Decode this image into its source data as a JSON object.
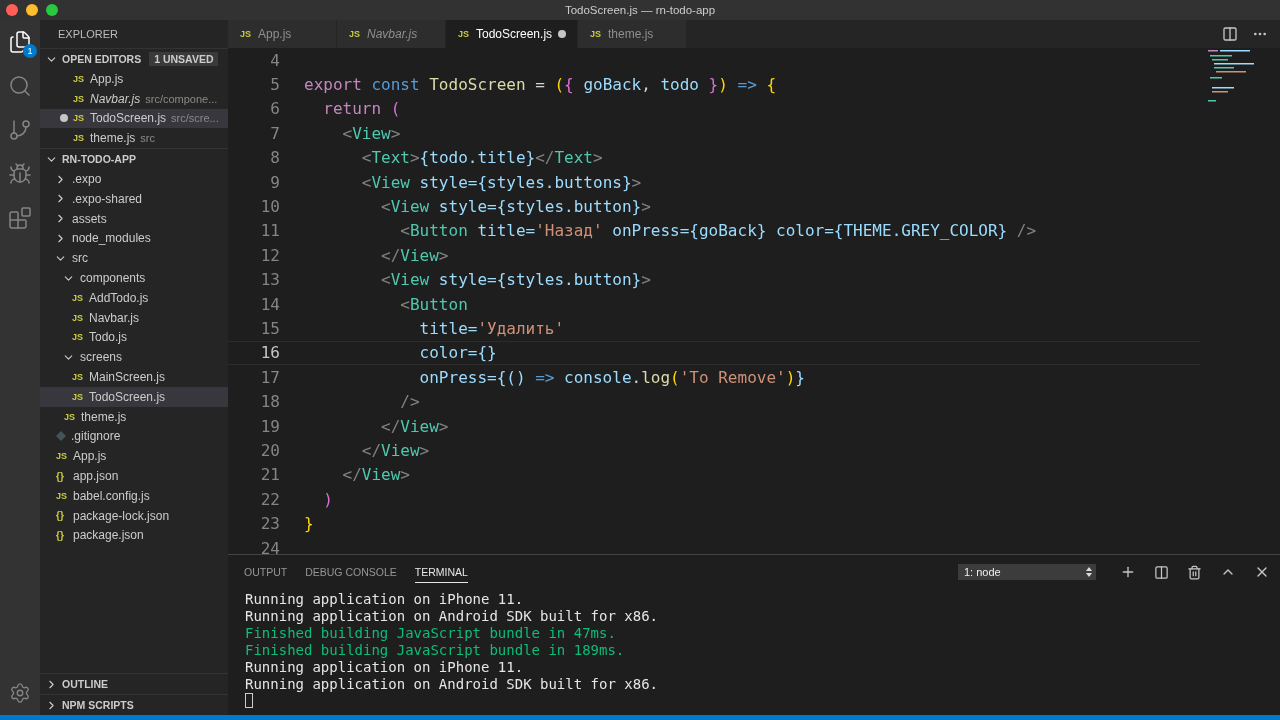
{
  "window": {
    "title": "TodoScreen.js — rn-todo-app"
  },
  "activity_bar": {
    "explorer_badge": "1"
  },
  "sidebar": {
    "title": "EXPLORER",
    "open_editors": {
      "title": "OPEN EDITORS",
      "badge": "1 UNSAVED",
      "expanded": true,
      "items": [
        {
          "icon": "JS",
          "name": "App.js",
          "dirty": false,
          "preview": false,
          "selected": false
        },
        {
          "icon": "JS",
          "name": "Navbar.js",
          "path": "src/compone...",
          "dirty": false,
          "preview": true,
          "selected": false
        },
        {
          "icon": "JS",
          "name": "TodoScreen.js",
          "path": "src/scre...",
          "dirty": true,
          "preview": false,
          "selected": true
        },
        {
          "icon": "JS",
          "name": "theme.js",
          "path": "src",
          "dirty": false,
          "preview": false,
          "selected": false
        }
      ]
    },
    "project": {
      "title": "RN-TODO-APP",
      "expanded": true,
      "items": [
        {
          "name": ".expo",
          "kind": "folder",
          "expanded": false,
          "selected": false
        },
        {
          "name": ".expo-shared",
          "kind": "folder",
          "expanded": false,
          "selected": false
        },
        {
          "name": "assets",
          "kind": "folder",
          "expanded": false,
          "selected": false
        },
        {
          "name": "node_modules",
          "kind": "folder",
          "expanded": false,
          "selected": false
        },
        {
          "name": "src",
          "kind": "folder",
          "expanded": true,
          "selected": false,
          "children": [
            {
              "name": "components",
              "kind": "folder",
              "expanded": true,
              "selected": false,
              "children": [
                {
                  "icon": "JS",
                  "name": "AddTodo.js",
                  "kind": "js",
                  "selected": false
                },
                {
                  "icon": "JS",
                  "name": "Navbar.js",
                  "kind": "js",
                  "selected": false
                },
                {
                  "icon": "JS",
                  "name": "Todo.js",
                  "kind": "js",
                  "selected": false
                }
              ]
            },
            {
              "name": "screens",
              "kind": "folder",
              "expanded": true,
              "selected": false,
              "children": [
                {
                  "icon": "JS",
                  "name": "MainScreen.js",
                  "kind": "js",
                  "selected": false
                },
                {
                  "icon": "JS",
                  "name": "TodoScreen.js",
                  "kind": "js",
                  "selected": true
                }
              ]
            },
            {
              "icon": "JS",
              "name": "theme.js",
              "kind": "js",
              "selected": false
            }
          ]
        },
        {
          "name": ".gitignore",
          "kind": "git",
          "selected": false
        },
        {
          "icon": "JS",
          "name": "App.js",
          "kind": "js",
          "selected": false
        },
        {
          "icon": "{}",
          "name": "app.json",
          "kind": "json",
          "selected": false
        },
        {
          "icon": "JS",
          "name": "babel.config.js",
          "kind": "js",
          "selected": false
        },
        {
          "icon": "{}",
          "name": "package-lock.json",
          "kind": "json",
          "selected": false
        },
        {
          "icon": "{}",
          "name": "package.json",
          "kind": "json",
          "selected": false
        }
      ]
    },
    "sections": [
      {
        "title": "OUTLINE",
        "expanded": false
      },
      {
        "title": "NPM SCRIPTS",
        "expanded": false
      }
    ]
  },
  "tabs": [
    {
      "icon": "JS",
      "label": "App.js",
      "selected": false,
      "dirty": false,
      "preview": false
    },
    {
      "icon": "JS",
      "label": "Navbar.js",
      "selected": false,
      "dirty": false,
      "preview": true
    },
    {
      "icon": "JS",
      "label": "TodoScreen.js",
      "selected": true,
      "dirty": true,
      "preview": false
    },
    {
      "icon": "JS",
      "label": "theme.js",
      "selected": false,
      "dirty": false,
      "preview": false
    }
  ],
  "editor": {
    "lines": [
      {
        "number": "4",
        "current": false
      },
      {
        "number": "5",
        "current": false,
        "tokens": [
          {
            "text": "export ",
            "kind": "kw"
          },
          {
            "text": "const ",
            "kind": "storage"
          },
          {
            "text": "TodoScreen",
            "kind": "func"
          },
          {
            "text": " = ",
            "kind": "plain"
          },
          {
            "text": "(",
            "kind": "b1"
          },
          {
            "text": "{",
            "kind": "b2"
          },
          {
            "text": " goBack",
            "kind": "var"
          },
          {
            "text": ", ",
            "kind": "plain"
          },
          {
            "text": "todo",
            "kind": "var"
          },
          {
            "text": " }",
            "kind": "b2"
          },
          {
            "text": ")",
            "kind": "b1"
          },
          {
            "text": " => ",
            "kind": "storage"
          },
          {
            "text": "{",
            "kind": "b1"
          }
        ]
      },
      {
        "number": "6",
        "current": false,
        "tokens": [
          {
            "text": "  return ",
            "kind": "kw"
          },
          {
            "text": "(",
            "kind": "b2"
          }
        ]
      },
      {
        "number": "7",
        "current": false,
        "tokens": [
          {
            "text": "    <",
            "kind": "punct"
          },
          {
            "text": "View",
            "kind": "tag"
          },
          {
            "text": ">",
            "kind": "punct"
          }
        ]
      },
      {
        "number": "8",
        "current": false,
        "tokens": [
          {
            "text": "      <",
            "kind": "punct"
          },
          {
            "text": "Text",
            "kind": "tag"
          },
          {
            "text": ">",
            "kind": "punct"
          },
          {
            "text": "{todo.title}",
            "kind": "var"
          },
          {
            "text": "</",
            "kind": "punct"
          },
          {
            "text": "Text",
            "kind": "tag"
          },
          {
            "text": ">",
            "kind": "punct"
          }
        ]
      },
      {
        "number": "9",
        "current": false,
        "tokens": [
          {
            "text": "      <",
            "kind": "punct"
          },
          {
            "text": "View",
            "kind": "tag"
          },
          {
            "text": " style={styles.buttons}",
            "kind": "var"
          },
          {
            "text": ">",
            "kind": "punct"
          }
        ]
      },
      {
        "number": "10",
        "current": false,
        "tokens": [
          {
            "text": "        <",
            "kind": "punct"
          },
          {
            "text": "View",
            "kind": "tag"
          },
          {
            "text": " style={styles.button}",
            "kind": "var"
          },
          {
            "text": ">",
            "kind": "punct"
          }
        ]
      },
      {
        "number": "11",
        "current": false,
        "tokens": [
          {
            "text": "          <",
            "kind": "punct"
          },
          {
            "text": "Button",
            "kind": "tag"
          },
          {
            "text": " title=",
            "kind": "var"
          },
          {
            "text": "'Назад'",
            "kind": "str"
          },
          {
            "text": " onPress={goBack} color={THEME.GREY_COLOR}",
            "kind": "var"
          },
          {
            "text": " />",
            "kind": "punct"
          }
        ]
      },
      {
        "number": "12",
        "current": false,
        "tokens": [
          {
            "text": "        </",
            "kind": "punct"
          },
          {
            "text": "View",
            "kind": "tag"
          },
          {
            "text": ">",
            "kind": "punct"
          }
        ]
      },
      {
        "number": "13",
        "current": false,
        "tokens": [
          {
            "text": "        <",
            "kind": "punct"
          },
          {
            "text": "View",
            "kind": "tag"
          },
          {
            "text": " style={styles.button}",
            "kind": "var"
          },
          {
            "text": ">",
            "kind": "punct"
          }
        ]
      },
      {
        "number": "14",
        "current": false,
        "tokens": [
          {
            "text": "          <",
            "kind": "punct"
          },
          {
            "text": "Button",
            "kind": "tag"
          }
        ]
      },
      {
        "number": "15",
        "current": false,
        "tokens": [
          {
            "text": "            title=",
            "kind": "var"
          },
          {
            "text": "'Удалить'",
            "kind": "str"
          }
        ]
      },
      {
        "number": "16",
        "current": true,
        "tokens": [
          {
            "text": "            color={}",
            "kind": "var"
          }
        ]
      },
      {
        "number": "17",
        "current": false,
        "tokens": [
          {
            "text": "            onPress={() ",
            "kind": "var"
          },
          {
            "text": "=>",
            "kind": "storage"
          },
          {
            "text": " console",
            "kind": "var"
          },
          {
            "text": ".",
            "kind": "plain"
          },
          {
            "text": "log",
            "kind": "func"
          },
          {
            "text": "(",
            "kind": "b1"
          },
          {
            "text": "'To Remove'",
            "kind": "str"
          },
          {
            "text": ")",
            "kind": "b1"
          },
          {
            "text": "}",
            "kind": "var"
          }
        ]
      },
      {
        "number": "18",
        "current": false,
        "tokens": [
          {
            "text": "          />",
            "kind": "punct"
          }
        ]
      },
      {
        "number": "19",
        "current": false,
        "tokens": [
          {
            "text": "        </",
            "kind": "punct"
          },
          {
            "text": "View",
            "kind": "tag"
          },
          {
            "text": ">",
            "kind": "punct"
          }
        ]
      },
      {
        "number": "20",
        "current": false,
        "tokens": [
          {
            "text": "      </",
            "kind": "punct"
          },
          {
            "text": "View",
            "kind": "tag"
          },
          {
            "text": ">",
            "kind": "punct"
          }
        ]
      },
      {
        "number": "21",
        "current": false,
        "tokens": [
          {
            "text": "    </",
            "kind": "punct"
          },
          {
            "text": "View",
            "kind": "tag"
          },
          {
            "text": ">",
            "kind": "punct"
          }
        ]
      },
      {
        "number": "22",
        "current": false,
        "tokens": [
          {
            "text": "  )",
            "kind": "b2"
          }
        ]
      },
      {
        "number": "23",
        "current": false,
        "tokens": [
          {
            "text": "}",
            "kind": "b1"
          }
        ]
      },
      {
        "number": "24",
        "current": false
      }
    ]
  },
  "panel": {
    "tabs": [
      {
        "label": "OUTPUT",
        "selected": false
      },
      {
        "label": "DEBUG CONSOLE",
        "selected": false
      },
      {
        "label": "TERMINAL",
        "selected": true
      }
    ],
    "terminal_select": "1: node",
    "lines": [
      {
        "text": "Running application on iPhone 11.",
        "kind": "info"
      },
      {
        "text": "Running application on Android SDK built for x86.",
        "kind": "info"
      },
      {
        "text": "Finished building JavaScript bundle in 47ms.",
        "kind": "success"
      },
      {
        "text": "Finished building JavaScript bundle in 189ms.",
        "kind": "success"
      },
      {
        "text": "Running application on iPhone 11.",
        "kind": "info"
      },
      {
        "text": "Running application on Android SDK built for x86.",
        "kind": "info"
      }
    ]
  }
}
